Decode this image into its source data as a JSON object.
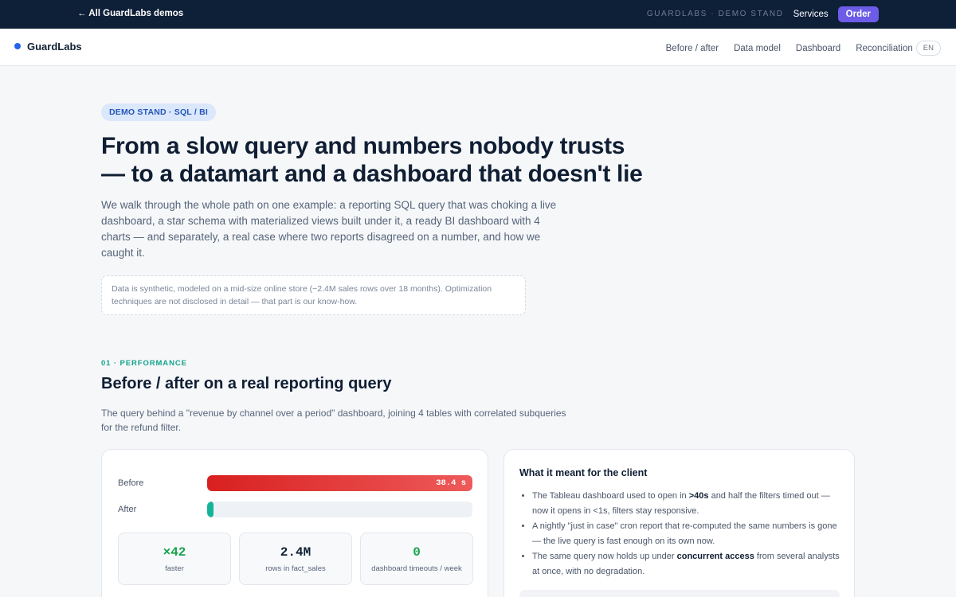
{
  "topbar": {
    "back_link": "← All GuardLabs demos",
    "stand_label": "GUARDLABS · DEMO STAND",
    "services": "Services",
    "order": "Order"
  },
  "navbar": {
    "brand": "GuardLabs",
    "links": [
      "Before / after",
      "Data model",
      "Dashboard",
      "Reconciliation"
    ],
    "lang": "EN"
  },
  "hero": {
    "badge": "DEMO STAND · SQL / BI",
    "title_line1": "From a slow query and numbers nobody trusts",
    "title_line2": "— to a datamart and a dashboard that doesn't lie",
    "lead": "We walk through the whole path on one example: a reporting SQL query that was choking a live dashboard, a star schema with materialized views built under it, a ready BI dashboard with 4 charts — and separately, a real case where two reports disagreed on a number, and how we caught it.",
    "note": "Data is synthetic, modeled on a mid-size online store (~2.4M sales rows over 18 months). Optimization techniques are not disclosed in detail — that part is our know-how."
  },
  "performance": {
    "kicker": "01 · PERFORMANCE",
    "title": "Before / after on a real reporting query",
    "description": "The query behind a \"revenue by channel over a period\" dashboard, joining 4 tables with correlated subqueries for the refund filter.",
    "before_label": "Before",
    "before_value": "38.4 s",
    "before_fill": 1.0,
    "after_label": "After",
    "stats": [
      {
        "value": "×42",
        "caption": "faster",
        "color": "#16a34a"
      },
      {
        "value": "2.4M",
        "caption": "rows in fact_sales",
        "color": "#0f1e33"
      },
      {
        "value": "0",
        "caption": "dashboard timeouts / week",
        "color": "#16a34a"
      }
    ]
  },
  "client": {
    "title": "What it meant for the client",
    "items": [
      {
        "pre": "The Tableau dashboard used to open in ",
        "bold": ">40s",
        "post": " and half the filters timed out — now it opens in <1s, filters stay responsive."
      },
      {
        "pre": "A nightly \"just in case\" cron report that re-computed the same numbers is gone — the live query is fast enough on its own now.",
        "bold": "",
        "post": ""
      },
      {
        "pre": "The same query now holds up under ",
        "bold": "concurrent access",
        "post": " from several analysts at once, with no degradation."
      }
    ]
  }
}
